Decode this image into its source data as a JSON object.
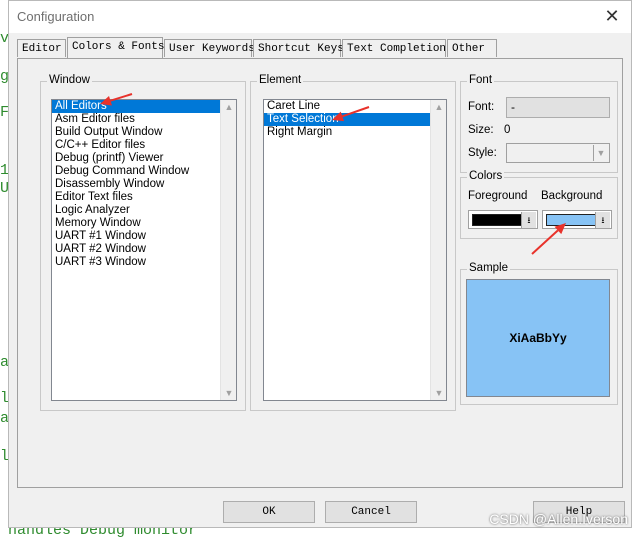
{
  "background_code": {
    "bottom_line": "handles Debug monitor",
    "margin_chars": [
      "v",
      "g",
      "F",
      "1",
      "U",
      "a",
      "l",
      "a",
      "l"
    ]
  },
  "window": {
    "title": "Configuration",
    "close_glyph": "✕"
  },
  "tabs": [
    {
      "label": "Editor",
      "active": false
    },
    {
      "label": "Colors & Fonts",
      "active": true
    },
    {
      "label": "User Keywords",
      "active": false
    },
    {
      "label": "Shortcut Keys",
      "active": false
    },
    {
      "label": "Text Completion",
      "active": false
    },
    {
      "label": "Other",
      "active": false
    }
  ],
  "window_group": {
    "label": "Window",
    "selected": "All Editors",
    "items": [
      "All Editors",
      "Asm Editor files",
      "Build Output Window",
      "C/C++ Editor files",
      "Debug (printf) Viewer",
      "Debug Command Window",
      "Disassembly Window",
      "Editor Text files",
      "Logic Analyzer",
      "Memory Window",
      "UART #1 Window",
      "UART #2 Window",
      "UART #3 Window"
    ]
  },
  "element_group": {
    "label": "Element",
    "selected": "Text Selection",
    "items": [
      "Caret Line",
      "Text Selection",
      "Right Margin"
    ]
  },
  "font_group": {
    "label": "Font",
    "font_label": "Font:",
    "font_button": "-",
    "size_label": "Size:",
    "size_value": "0",
    "style_label": "Style:",
    "style_value": ""
  },
  "colors_group": {
    "label": "Colors",
    "foreground_label": "Foreground",
    "background_label": "Background",
    "foreground_color": "#000000",
    "background_color": "#87c3f5"
  },
  "sample_group": {
    "label": "Sample",
    "text": "XiAaBbYy",
    "background_color": "#87c3f5",
    "text_color": "#000000"
  },
  "buttons": {
    "ok": "OK",
    "cancel": "Cancel",
    "help": "Help"
  },
  "watermark": "CSDN @Allen.Iverson",
  "annotation_color": "#e8322b"
}
